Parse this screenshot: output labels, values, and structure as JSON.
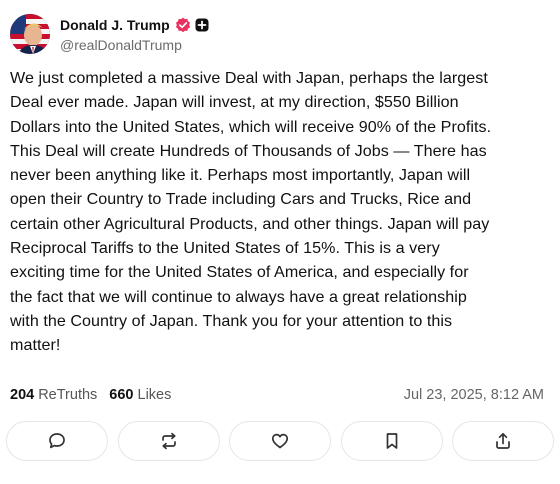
{
  "author": {
    "display_name": "Donald J. Trump",
    "handle": "@realDonaldTrump",
    "avatar_icon": "avatar-flag-portrait",
    "verified_icon": "verified-badge-icon",
    "verified_color": "#e8335e",
    "follow_icon": "plus-square-icon"
  },
  "post": {
    "lines": [
      "We just completed a massive Deal with Japan, perhaps the largest",
      "Deal ever made. Japan will invest, at my direction, $550 Billion",
      "Dollars into the United States, which will receive 90% of the Profits.",
      "This Deal will create Hundreds of Thousands of Jobs — There has",
      "never been anything like it. Perhaps most importantly, Japan will",
      "open their Country to Trade including Cars and Trucks, Rice and",
      "certain other Agricultural Products, and other things. Japan will pay",
      "Reciprocal Tariffs to the United States of 15%. This is a very",
      "exciting time for the United States of America, and especially for",
      "the fact that we will continue to always have a great relationship",
      "with the Country of Japan. Thank you for your attention to this",
      "matter!"
    ]
  },
  "stats": {
    "retruths_count": "204",
    "retruths_label": "ReTruths",
    "likes_count": "660",
    "likes_label": "Likes",
    "timestamp": "Jul 23, 2025, 8:12 AM"
  },
  "actions": [
    {
      "name": "reply-button",
      "icon": "comment-bubble-icon"
    },
    {
      "name": "retruth-button",
      "icon": "repost-arrows-icon"
    },
    {
      "name": "like-button",
      "icon": "heart-icon"
    },
    {
      "name": "bookmark-button",
      "icon": "bookmark-icon"
    },
    {
      "name": "share-button",
      "icon": "share-upload-icon"
    }
  ]
}
